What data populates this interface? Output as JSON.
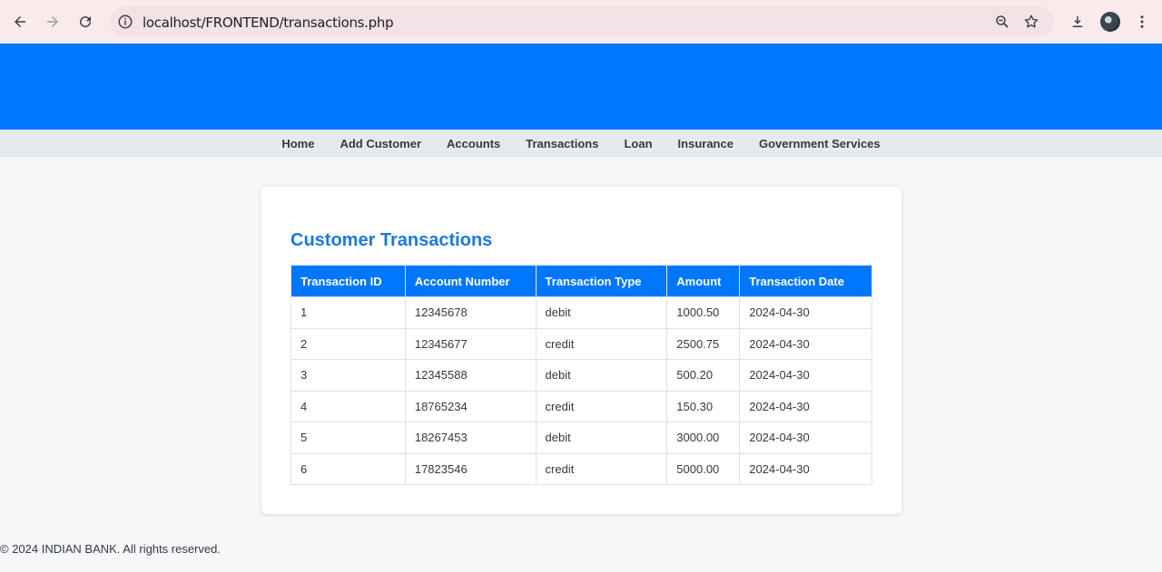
{
  "browser": {
    "url": "localhost/FRONTEND/transactions.php",
    "icons": [
      "back-arrow-icon",
      "forward-arrow-icon",
      "reload-icon",
      "info-icon",
      "zoom-icon",
      "star-icon",
      "download-icon",
      "avatar",
      "kebab-menu-icon"
    ]
  },
  "nav": {
    "items": [
      "Home",
      "Add Customer",
      "Accounts",
      "Transactions",
      "Loan",
      "Insurance",
      "Government Services"
    ]
  },
  "main": {
    "title": "Customer Transactions",
    "columns": [
      "Transaction ID",
      "Account Number",
      "Transaction Type",
      "Amount",
      "Transaction Date"
    ],
    "rows": [
      [
        "1",
        "12345678",
        "debit",
        "1000.50",
        "2024-04-30"
      ],
      [
        "2",
        "12345677",
        "credit",
        "2500.75",
        "2024-04-30"
      ],
      [
        "3",
        "12345588",
        "debit",
        "500.20",
        "2024-04-30"
      ],
      [
        "4",
        "18765234",
        "credit",
        "150.30",
        "2024-04-30"
      ],
      [
        "5",
        "18267453",
        "debit",
        "3000.00",
        "2024-04-30"
      ],
      [
        "6",
        "17823546",
        "credit",
        "5000.00",
        "2024-04-30"
      ]
    ]
  },
  "footer": {
    "text": "© 2024 INDIAN BANK. All rights reserved."
  },
  "colors": {
    "brand_blue": "#0077fe",
    "title_blue": "#1a78e6",
    "nav_bg": "#e7eaed"
  }
}
